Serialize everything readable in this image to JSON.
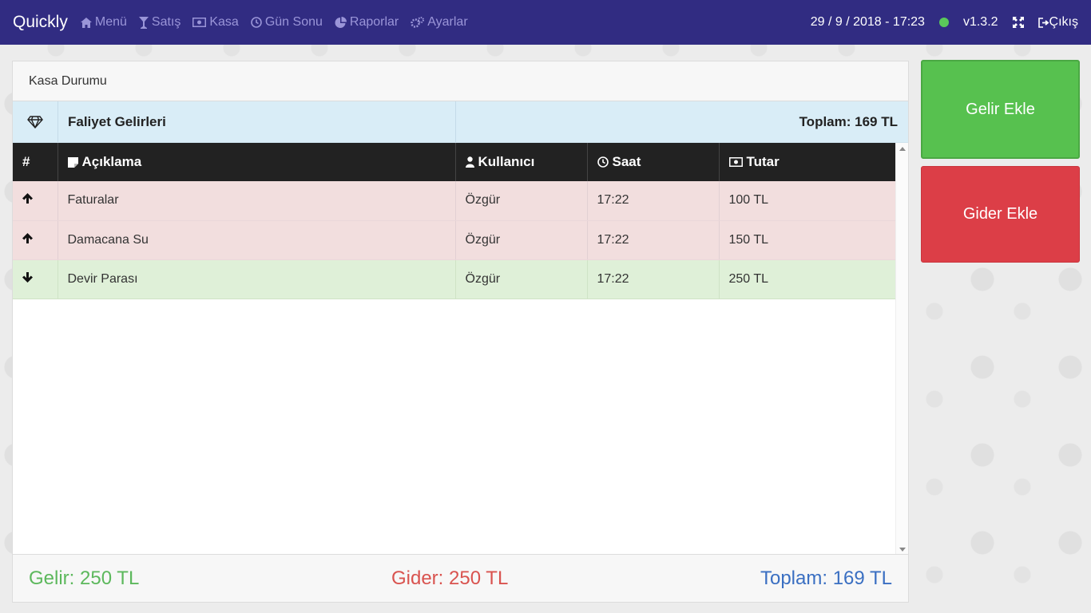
{
  "navbar": {
    "brand": "Quickly",
    "items": [
      {
        "label": "Menü",
        "icon": "home-icon"
      },
      {
        "label": "Satış",
        "icon": "cocktail-icon"
      },
      {
        "label": "Kasa",
        "icon": "money-icon"
      },
      {
        "label": "Gün Sonu",
        "icon": "clock-icon"
      },
      {
        "label": "Raporlar",
        "icon": "pie-chart-icon"
      },
      {
        "label": "Ayarlar",
        "icon": "gears-icon"
      }
    ],
    "datetime": "29 / 9 / 2018 - 17:23",
    "status_color": "#5ac85a",
    "version": "v1.3.2",
    "logout_label": "Çıkış"
  },
  "panel": {
    "heading": "Kasa Durumu",
    "income_title": "Faliyet Gelirleri",
    "income_total": "Toplam: 169 TL",
    "columns": [
      "#",
      "Açıklama",
      "Kullanıcı",
      "Saat",
      "Tutar"
    ],
    "rows": [
      {
        "direction": "up",
        "description": "Faturalar",
        "user": "Özgür",
        "time": "17:22",
        "amount": "100 TL"
      },
      {
        "direction": "up",
        "description": "Damacana Su",
        "user": "Özgür",
        "time": "17:22",
        "amount": "150 TL"
      },
      {
        "direction": "down",
        "description": "Devir Parası",
        "user": "Özgür",
        "time": "17:22",
        "amount": "250 TL"
      }
    ],
    "footer": {
      "income": "Gelir: 250 TL",
      "expense": "Gider: 250 TL",
      "total": "Toplam: 169 TL"
    }
  },
  "actions": {
    "add_income": "Gelir Ekle",
    "add_expense": "Gider Ekle"
  },
  "colors": {
    "navbar": "#312c82",
    "income_green": "#57c14f",
    "expense_red": "#dc3e47",
    "total_blue": "#3a6fc2"
  }
}
